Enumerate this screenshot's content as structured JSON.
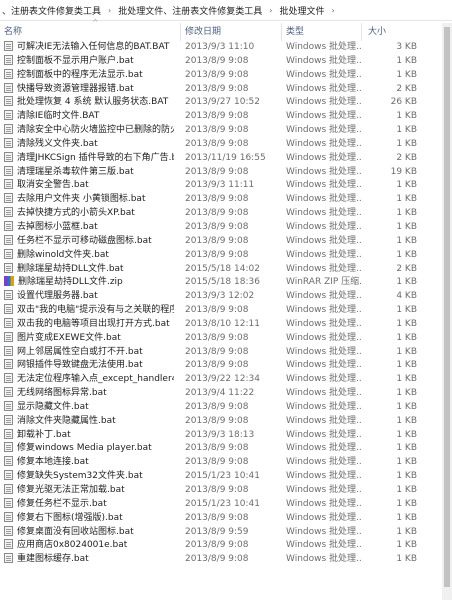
{
  "breadcrumb": [
    "、注册表文件修复类工具",
    "批处理文件、注册表文件修复类工具",
    "批处理文件"
  ],
  "breadcrumb_sep": "›",
  "columns": {
    "name": "名称",
    "date": "修改日期",
    "type": "类型",
    "size": "大小"
  },
  "sort_indicator": "^",
  "files": [
    {
      "name": "可解决IE无法输入任何信息的BAT.BAT",
      "date": "2013/9/3 11:10",
      "type": "Windows 批处理...",
      "size": "3 KB",
      "icon": "bat-file-icon"
    },
    {
      "name": "控制面板不显示用户账户.bat",
      "date": "2013/8/9 9:08",
      "type": "Windows 批处理...",
      "size": "1 KB",
      "icon": "bat-file-icon"
    },
    {
      "name": "控制面板中的程序无法显示.bat",
      "date": "2013/8/9 9:08",
      "type": "Windows 批处理...",
      "size": "1 KB",
      "icon": "bat-file-icon"
    },
    {
      "name": "快播导致资源管理器报错.bat",
      "date": "2013/8/9 9:08",
      "type": "Windows 批处理...",
      "size": "2 KB",
      "icon": "bat-file-icon"
    },
    {
      "name": "批处理恢复 4 系统 默认服务状态.BAT",
      "date": "2013/9/27 10:52",
      "type": "Windows 批处理...",
      "size": "26 KB",
      "icon": "bat-file-icon"
    },
    {
      "name": "清除IE临时文件.BAT",
      "date": "2013/8/9 9:08",
      "type": "Windows 批处理...",
      "size": "1 KB",
      "icon": "bat-file-icon"
    },
    {
      "name": "清除安全中心防火墙监控中已删除的防火...",
      "date": "2013/8/9 9:08",
      "type": "Windows 批处理...",
      "size": "1 KB",
      "icon": "bat-file-icon"
    },
    {
      "name": "清除残义文件夹.bat",
      "date": "2013/8/9 9:08",
      "type": "Windows 批处理...",
      "size": "1 KB",
      "icon": "bat-file-icon"
    },
    {
      "name": "清理JHKCSign 插件导致的右下角广告.bat",
      "date": "2013/11/19 16:55",
      "type": "Windows 批处理...",
      "size": "2 KB",
      "icon": "bat-file-icon"
    },
    {
      "name": "清理瑞星杀毒软件第三版.bat",
      "date": "2013/8/9 9:08",
      "type": "Windows 批处理...",
      "size": "19 KB",
      "icon": "bat-file-icon"
    },
    {
      "name": "取消安全警告.bat",
      "date": "2013/9/3 11:11",
      "type": "Windows 批处理...",
      "size": "1 KB",
      "icon": "bat-file-icon"
    },
    {
      "name": "去除用户文件夹 小黄锁图标.bat",
      "date": "2013/8/9 9:08",
      "type": "Windows 批处理...",
      "size": "1 KB",
      "icon": "bat-file-icon"
    },
    {
      "name": "去掉快捷方式的小箭头XP.bat",
      "date": "2013/8/9 9:08",
      "type": "Windows 批处理...",
      "size": "1 KB",
      "icon": "bat-file-icon"
    },
    {
      "name": "去掉图标小蓝框.bat",
      "date": "2013/8/9 9:08",
      "type": "Windows 批处理...",
      "size": "1 KB",
      "icon": "bat-file-icon"
    },
    {
      "name": "任务栏不显示可移动磁盘图标.bat",
      "date": "2013/8/9 9:08",
      "type": "Windows 批处理...",
      "size": "1 KB",
      "icon": "bat-file-icon"
    },
    {
      "name": "删除winold文件夹.bat",
      "date": "2013/8/9 9:08",
      "type": "Windows 批处理...",
      "size": "1 KB",
      "icon": "bat-file-icon"
    },
    {
      "name": "删除瑞星劫持DLL文件.bat",
      "date": "2015/5/18 14:02",
      "type": "Windows 批处理...",
      "size": "2 KB",
      "icon": "bat-file-icon"
    },
    {
      "name": "删除瑞星劫持DLL文件.zip",
      "date": "2015/5/18 18:36",
      "type": "WinRAR ZIP 压缩...",
      "size": "1 KB",
      "icon": "zip-file-icon"
    },
    {
      "name": "设置代理服务器.bat",
      "date": "2013/9/3 12:02",
      "type": "Windows 批处理...",
      "size": "4 KB",
      "icon": "bat-file-icon"
    },
    {
      "name": "双击\"我的电脑\"提示没有与之关联的程序...",
      "date": "2013/8/9 9:08",
      "type": "Windows 批处理...",
      "size": "1 KB",
      "icon": "bat-file-icon"
    },
    {
      "name": "双击我的电脑等项目出现打开方式.bat",
      "date": "2013/8/10 12:11",
      "type": "Windows 批处理...",
      "size": "1 KB",
      "icon": "bat-file-icon"
    },
    {
      "name": "图片变成EXEWE文件.bat",
      "date": "2013/8/9 9:08",
      "type": "Windows 批处理...",
      "size": "1 KB",
      "icon": "bat-file-icon"
    },
    {
      "name": "网上邻居属性空白或打不开.bat",
      "date": "2013/8/9 9:08",
      "type": "Windows 批处理...",
      "size": "1 KB",
      "icon": "bat-file-icon"
    },
    {
      "name": "网银插件导致键盘无法使用.bat",
      "date": "2013/8/9 9:08",
      "type": "Windows 批处理...",
      "size": "1 KB",
      "icon": "bat-file-icon"
    },
    {
      "name": "无法定位程序输入点_except_handler4_...",
      "date": "2013/9/22 12:34",
      "type": "Windows 批处理...",
      "size": "1 KB",
      "icon": "bat-file-icon"
    },
    {
      "name": "无线网络图标异常.bat",
      "date": "2013/9/4 11:22",
      "type": "Windows 批处理...",
      "size": "1 KB",
      "icon": "bat-file-icon"
    },
    {
      "name": "显示隐藏文件.bat",
      "date": "2013/8/9 9:08",
      "type": "Windows 批处理...",
      "size": "1 KB",
      "icon": "bat-file-icon"
    },
    {
      "name": "消除文件夹隐藏属性.bat",
      "date": "2013/8/9 9:08",
      "type": "Windows 批处理...",
      "size": "1 KB",
      "icon": "bat-file-icon"
    },
    {
      "name": "卸载补丁.bat",
      "date": "2013/9/3 18:13",
      "type": "Windows 批处理...",
      "size": "1 KB",
      "icon": "bat-file-icon"
    },
    {
      "name": "修复windows Media player.bat",
      "date": "2013/8/9 9:08",
      "type": "Windows 批处理...",
      "size": "1 KB",
      "icon": "bat-file-icon"
    },
    {
      "name": "修复本地连接.bat",
      "date": "2013/8/9 9:08",
      "type": "Windows 批处理...",
      "size": "1 KB",
      "icon": "bat-file-icon"
    },
    {
      "name": "修复缺失System32文件夹.bat",
      "date": "2015/1/23 10:41",
      "type": "Windows 批处理...",
      "size": "1 KB",
      "icon": "bat-file-icon"
    },
    {
      "name": "修复光驱无法正常加载.bat",
      "date": "2013/8/9 9:08",
      "type": "Windows 批处理...",
      "size": "1 KB",
      "icon": "bat-file-icon"
    },
    {
      "name": "修复任务栏不显示.bat",
      "date": "2015/1/23 10:41",
      "type": "Windows 批处理...",
      "size": "1 KB",
      "icon": "bat-file-icon"
    },
    {
      "name": "修复右下图标(增强版).bat",
      "date": "2013/8/9 9:08",
      "type": "Windows 批处理...",
      "size": "1 KB",
      "icon": "bat-file-icon"
    },
    {
      "name": "修复桌面没有回收站图标.bat",
      "date": "2013/8/9 9:59",
      "type": "Windows 批处理...",
      "size": "1 KB",
      "icon": "bat-file-icon"
    },
    {
      "name": "应用商店0x8024001e.bat",
      "date": "2013/8/9 9:08",
      "type": "Windows 批处理...",
      "size": "1 KB",
      "icon": "bat-file-icon"
    },
    {
      "name": "重建图标缓存.bat",
      "date": "2013/8/9 9:08",
      "type": "Windows 批处理...",
      "size": "1 KB",
      "icon": "bat-file-icon"
    }
  ]
}
